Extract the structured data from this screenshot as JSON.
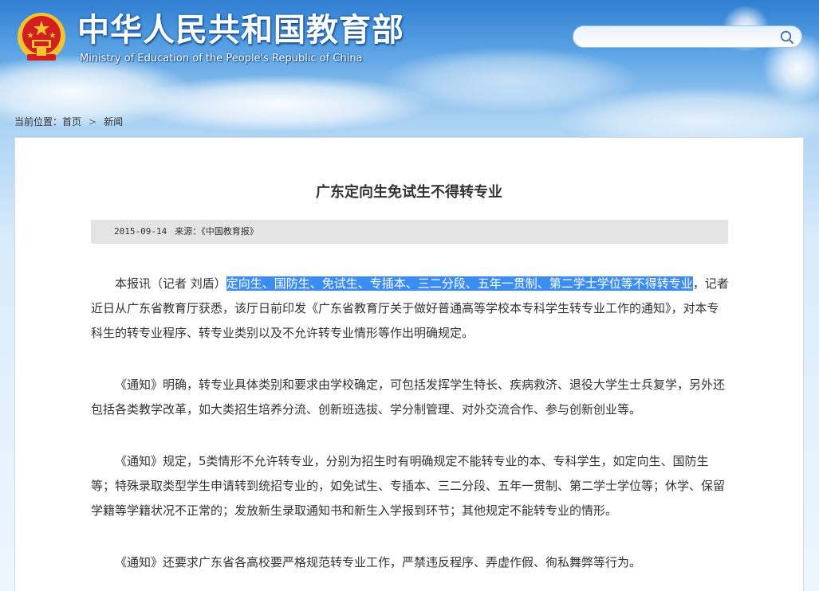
{
  "header": {
    "title": "中华人民共和国教育部",
    "subtitle": "Ministry of Education of the People's Republic of China",
    "search_placeholder": ""
  },
  "icons": {
    "emblem": "national-emblem-icon",
    "search": "search-icon",
    "breadcrumb_separator": "chevron-right-icon"
  },
  "breadcrumb": {
    "label": "当前位置：",
    "home": "首页",
    "separator": ">",
    "current": "新闻"
  },
  "article": {
    "title": "广东定向生免试生不得转专业",
    "date": "2015-09-14",
    "source": "来源：《中国教育报》",
    "p1_lead": "本报讯（记者 刘盾）",
    "p1_highlight": "定向生、国防生、免试生、专插本、三二分段、五年一贯制、第二学士学位等不得转专业",
    "p1_rest": "，记者近日从广东省教育厅获悉，该厅日前印发《广东省教育厅关于做好普通高等学校本专科学生转专业工作的通知》，对本专科生的转专业程序、转专业类别以及不允许转专业情形等作出明确规定。",
    "p2": "《通知》明确，转专业具体类别和要求由学校确定，可包括发挥学生特长、疾病救济、退役大学生士兵复学，另外还包括各类教学改革，如大类招生培养分流、创新班选拔、学分制管理、对外交流合作、参与创新创业等。",
    "p3": "《通知》规定，5类情形不允许转专业，分别为招生时有明确规定不能转专业的本、专科学生，如定向生、国防生等；特殊录取类型学生申请转到统招专业的，如免试生、专插本、三二分段、五年一贯制、第二学士学位等；休学、保留学籍等学籍状况不正常的；发放新生录取通知书和新生入学报到环节；其他规定不能转专业的情形。",
    "p4": "《通知》还要求广东省各高校要严格规范转专业工作，严禁违反程序、弄虚作假、徇私舞弊等行为。"
  },
  "colors": {
    "selection_highlight": "#3b8df2",
    "header_blue": "#2f7fd2",
    "emblem_red": "#d21f1f",
    "emblem_gold": "#f2c230"
  }
}
